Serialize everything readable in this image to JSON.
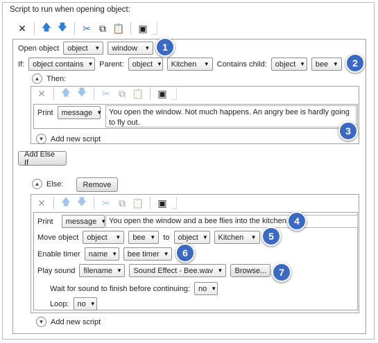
{
  "header": {
    "title": "Script to run when opening object:"
  },
  "toolbar": {
    "icons": [
      "delete-icon",
      "move-up-icon",
      "move-down-icon",
      "cut-icon",
      "copy-icon",
      "paste-icon",
      "code-view-icon"
    ]
  },
  "open_row": {
    "label": "Open object",
    "obj_type": "object",
    "obj_value": "window"
  },
  "if_row": {
    "if_label": "If:",
    "condition": "object contains",
    "parent_label": "Parent:",
    "parent_type": "object",
    "parent_value": "Kitchen",
    "child_label": "Contains child:",
    "child_type": "object",
    "child_value": "bee"
  },
  "then": {
    "label": "Then:",
    "print_label": "Print",
    "print_type": "message",
    "print_text": "You open the window. Not much happens. An angry bee is hardly going to fly out.",
    "add_script": "Add new script"
  },
  "add_else_if": "Add Else If",
  "else": {
    "label": "Else:",
    "remove": "Remove",
    "print_label": "Print",
    "print_type": "message",
    "print_text": "You open the window and a bee flies into the kitchen.",
    "move_label": "Move object",
    "move_type": "object",
    "move_value": "bee",
    "to_label": "to",
    "to_type": "object",
    "to_value": "Kitchen",
    "timer_label": "Enable timer",
    "timer_type": "name",
    "timer_value": "bee timer",
    "sound_label": "Play sound",
    "sound_type": "filename",
    "sound_value": "Sound Effect - Bee.wav",
    "browse": "Browse...",
    "wait_label": "Wait for sound to finish before continuing:",
    "wait_value": "no",
    "loop_label": "Loop:",
    "loop_value": "no",
    "add_script": "Add new script"
  },
  "badges": [
    "1",
    "2",
    "3",
    "4",
    "5",
    "6",
    "7"
  ],
  "colors": {
    "badge": "#3a6ac4",
    "arrow": "#2f7fd8"
  }
}
